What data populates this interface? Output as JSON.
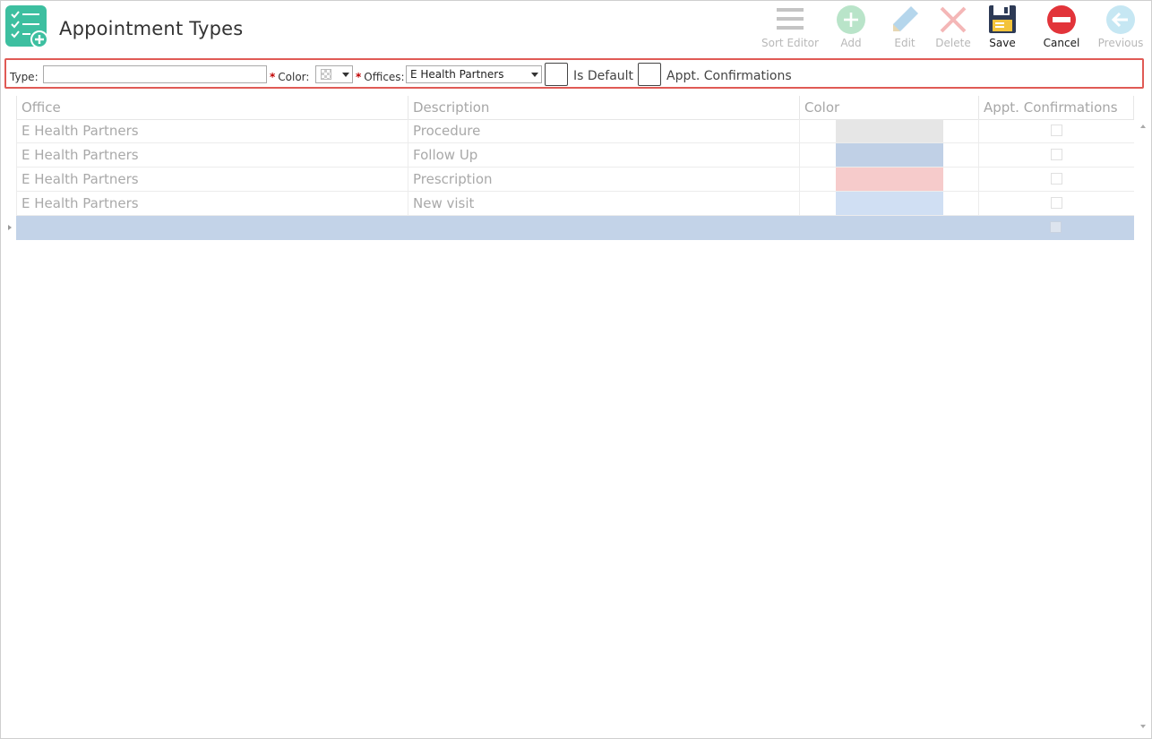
{
  "header": {
    "title": "Appointment Types",
    "app_icon": "checklist-add-icon"
  },
  "toolbar": {
    "sort_editor": {
      "label": "Sort Editor",
      "icon": "hamburger-icon",
      "enabled": false
    },
    "add": {
      "label": "Add",
      "icon": "plus-circle-icon",
      "enabled": false
    },
    "edit": {
      "label": "Edit",
      "icon": "pencil-icon",
      "enabled": false
    },
    "delete": {
      "label": "Delete",
      "icon": "x-icon",
      "enabled": false
    },
    "save": {
      "label": "Save",
      "icon": "floppy-disk-icon",
      "enabled": true
    },
    "cancel": {
      "label": "Cancel",
      "icon": "minus-circle-icon",
      "enabled": true
    },
    "previous": {
      "label": "Previous",
      "icon": "arrow-left-circle-icon",
      "enabled": false
    }
  },
  "filter": {
    "type_label": "Type:",
    "type_value": "",
    "color_label": "Color:",
    "required_marker": "*",
    "offices_label": "Offices:",
    "offices_value": "E Health Partners",
    "is_default_label": "Is Default",
    "is_default_checked": false,
    "appt_confirmations_label": "Appt. Confirmations",
    "appt_confirmations_checked": false
  },
  "grid": {
    "columns": [
      "Office",
      "Description",
      "Color",
      "Appt. Confirmations"
    ],
    "rows": [
      {
        "office": "E Health Partners",
        "description": "Procedure",
        "color": "#e6e6e6",
        "confirmations": false
      },
      {
        "office": "E Health Partners",
        "description": "Follow Up",
        "color": "#c0d0e6",
        "confirmations": false
      },
      {
        "office": "E Health Partners",
        "description": "Prescription",
        "color": "#f6cbcb",
        "confirmations": false
      },
      {
        "office": "E Health Partners",
        "description": "New visit",
        "color": "#d0dff3",
        "confirmations": false
      }
    ],
    "new_row": {
      "office": "",
      "description": "",
      "confirmations": false
    }
  },
  "colors": {
    "accent_teal": "#3dbfa0",
    "highlight_border": "#e05a55",
    "selected_row": "#c3d3e8",
    "cancel_red": "#e2343a",
    "save_navy": "#2d3a55"
  }
}
